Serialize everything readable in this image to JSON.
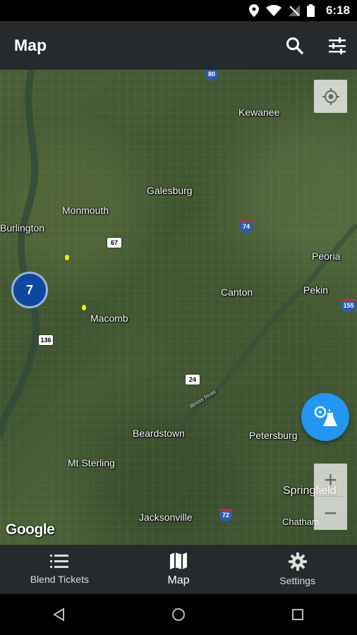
{
  "status_bar": {
    "time": "6:18"
  },
  "app_bar": {
    "title": "Map"
  },
  "map": {
    "cities": [
      {
        "id": "kewanee",
        "name": "Kewanee"
      },
      {
        "id": "galesburg",
        "name": "Galesburg"
      },
      {
        "id": "monmouth",
        "name": "Monmouth"
      },
      {
        "id": "burlington",
        "name": "Burlington"
      },
      {
        "id": "peoria",
        "name": "Peoria"
      },
      {
        "id": "canton",
        "name": "Canton"
      },
      {
        "id": "pekin",
        "name": "Pekin"
      },
      {
        "id": "macomb",
        "name": "Macomb"
      },
      {
        "id": "beardstown",
        "name": "Beardstown"
      },
      {
        "id": "petersburg",
        "name": "Petersburg"
      },
      {
        "id": "mt-sterling",
        "name": "Mt Sterling"
      },
      {
        "id": "springfield",
        "name": "Springfield"
      },
      {
        "id": "jacksonville",
        "name": "Jacksonville"
      },
      {
        "id": "chatham",
        "name": "Chatham"
      }
    ],
    "highways": [
      "80",
      "74",
      "67",
      "136",
      "24",
      "155",
      "72"
    ],
    "cluster_count": "7",
    "attribution": "Google",
    "zoom_in": "+",
    "zoom_out": "−",
    "river_label": "Illinois River"
  },
  "bottom_nav": {
    "items": [
      {
        "label": "Blend Tickets",
        "icon": "list-icon"
      },
      {
        "label": "Map",
        "icon": "map-icon"
      },
      {
        "label": "Settings",
        "icon": "gear-icon"
      }
    ],
    "active_index": 1
  },
  "colors": {
    "app_bar": "#262a2d",
    "accent": "#2196f3",
    "cluster": "#0d47a1",
    "marker": "#f2f200"
  }
}
